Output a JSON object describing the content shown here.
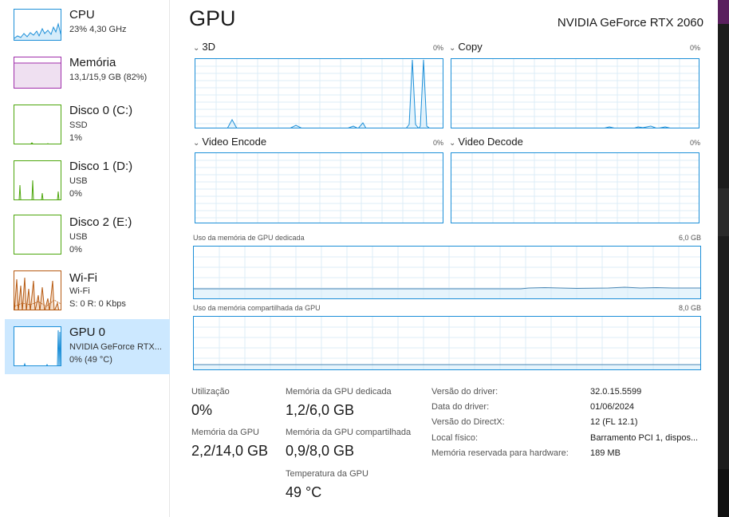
{
  "sidebar": {
    "items": [
      {
        "title": "CPU",
        "sub1": "23% 4,30 GHz",
        "sub2": "",
        "sub3": ""
      },
      {
        "title": "Memória",
        "sub1": "13,1/15,9 GB (82%)",
        "sub2": "",
        "sub3": ""
      },
      {
        "title": "Disco 0 (C:)",
        "sub1": "SSD",
        "sub2": "1%",
        "sub3": ""
      },
      {
        "title": "Disco 1 (D:)",
        "sub1": "USB",
        "sub2": "0%",
        "sub3": ""
      },
      {
        "title": "Disco 2 (E:)",
        "sub1": "USB",
        "sub2": "0%",
        "sub3": ""
      },
      {
        "title": "Wi-Fi",
        "sub1": "Wi-Fi",
        "sub2": "S: 0 R: 0 Kbps",
        "sub3": ""
      },
      {
        "title": "GPU 0",
        "sub1": "NVIDIA GeForce RTX...",
        "sub2": "0% (49 °C)",
        "sub3": ""
      }
    ],
    "active_index": 6
  },
  "header": {
    "title": "GPU",
    "device": "NVIDIA GeForce RTX 2060"
  },
  "graphs": {
    "engine_3d": {
      "label": "3D",
      "pct": "0%"
    },
    "copy": {
      "label": "Copy",
      "pct": "0%"
    },
    "video_encode": {
      "label": "Video Encode",
      "pct": "0%"
    },
    "video_decode": {
      "label": "Video Decode",
      "pct": "0%"
    },
    "dedicated_mem": {
      "label": "Uso da memória de GPU dedicada",
      "max": "6,0 GB"
    },
    "shared_mem": {
      "label": "Uso da memória compartilhada da GPU",
      "max": "8,0 GB"
    }
  },
  "stats": {
    "utilization": {
      "label": "Utilização",
      "value": "0%"
    },
    "dedicated": {
      "label": "Memória da GPU dedicada",
      "value": "1,2/6,0 GB"
    },
    "gpu_memory": {
      "label": "Memória da GPU",
      "value": "2,2/14,0 GB"
    },
    "shared": {
      "label": "Memória da GPU compartilhada",
      "value": "0,9/8,0 GB"
    },
    "temperature": {
      "label": "Temperatura da GPU",
      "value": "49 °C"
    }
  },
  "properties": [
    {
      "label": "Versão do driver:",
      "value": "32.0.15.5599"
    },
    {
      "label": "Data do driver:",
      "value": "01/06/2024"
    },
    {
      "label": "Versão do DirectX:",
      "value": "12 (FL 12.1)"
    },
    {
      "label": "Local físico:",
      "value": "Barramento PCI 1, dispos..."
    },
    {
      "label": "Memória reservada para hardware:",
      "value": "189 MB"
    }
  ],
  "colors": {
    "accent": "#1c8fd8",
    "memory": "#a02eab",
    "disk": "#4da60c",
    "network": "#b65a12",
    "selected": "#cce8ff"
  },
  "icons": {
    "chevron": "chevron-down-icon"
  }
}
